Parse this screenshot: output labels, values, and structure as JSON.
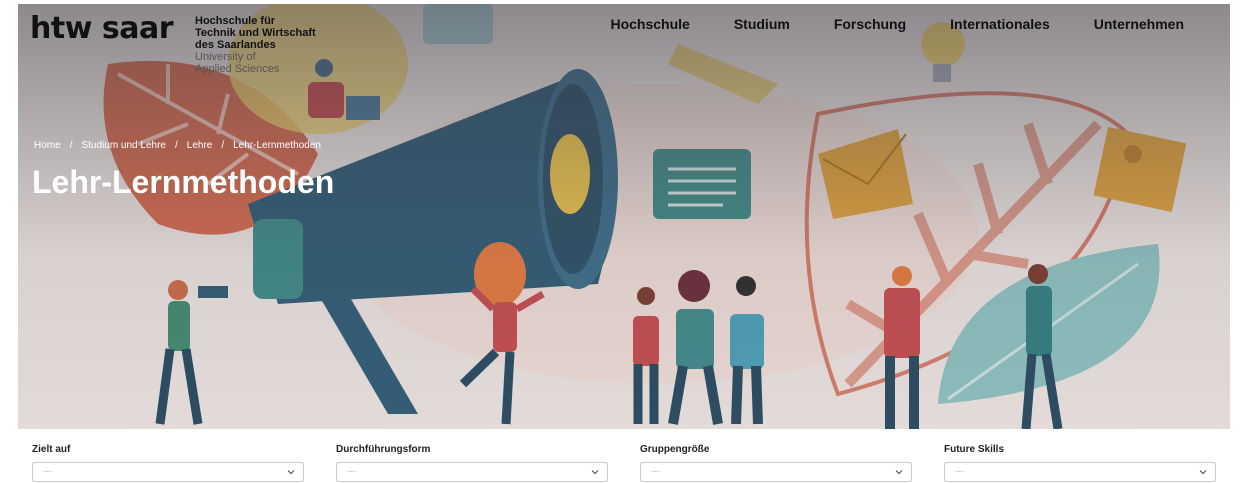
{
  "header": {
    "logo_text": "htw saar",
    "logo_sub": {
      "line1": "Hochschule für",
      "line2": "Technik und Wirtschaft",
      "line3": "des Saarlandes",
      "line4": "University of",
      "line5": "Applied Sciences"
    },
    "nav": [
      {
        "label": "Hochschule"
      },
      {
        "label": "Studium"
      },
      {
        "label": "Forschung"
      },
      {
        "label": "Internationales"
      },
      {
        "label": "Unternehmen"
      }
    ]
  },
  "breadcrumb": [
    "Home",
    "Studium und Lehre",
    "Lehre",
    "Lehr-Lernmethoden"
  ],
  "breadcrumb_sep": "/",
  "page_title": "Lehr-Lernmethoden",
  "filters": [
    {
      "label": "Zielt auf",
      "value": "---"
    },
    {
      "label": "Durchführungsform",
      "value": "---"
    },
    {
      "label": "Gruppengröße",
      "value": "---"
    },
    {
      "label": "Future Skills",
      "value": "---"
    }
  ]
}
